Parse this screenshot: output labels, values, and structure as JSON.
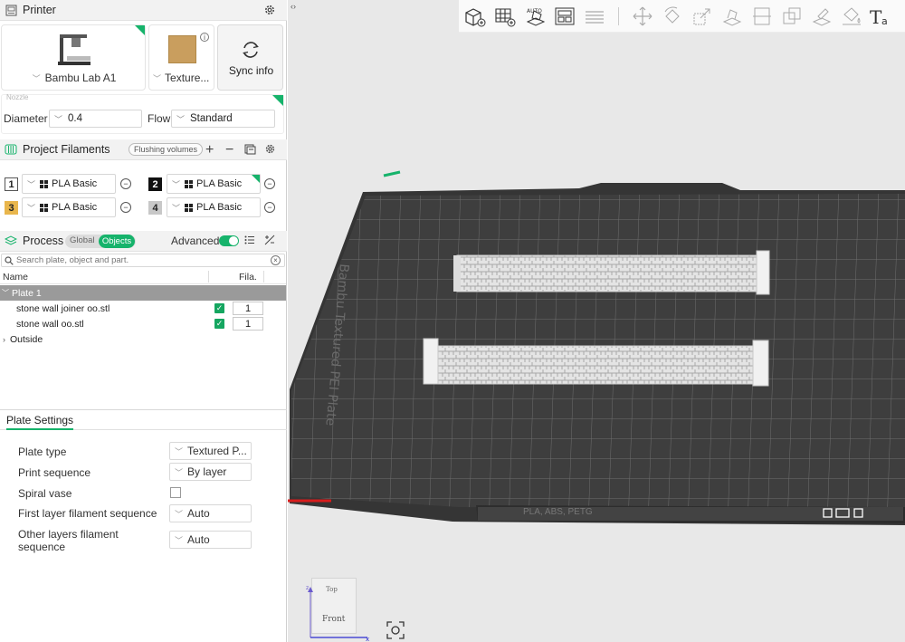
{
  "printer": {
    "section_title": "Printer",
    "model": "Bambu Lab A1",
    "plate": "Texture...",
    "sync_label": "Sync info",
    "nozzle_label": "Nozzle",
    "diameter_label": "Diameter",
    "diameter_value": "0.4",
    "flow_label": "Flow",
    "flow_value": "Standard"
  },
  "filaments": {
    "section_title": "Project Filaments",
    "flushing_label": "Flushing volumes",
    "items": [
      {
        "index": "1",
        "name": "PLA Basic",
        "color": "#ffffff"
      },
      {
        "index": "2",
        "name": "PLA Basic",
        "color": "#111111"
      },
      {
        "index": "3",
        "name": "PLA Basic",
        "color": "#e9b64c"
      },
      {
        "index": "4",
        "name": "PLA Basic",
        "color": "#c8c8c8"
      }
    ]
  },
  "process": {
    "section_title": "Process",
    "tab_global": "Global",
    "tab_objects": "Objects",
    "advanced_label": "Advanced",
    "search_placeholder": "Search plate, object and part."
  },
  "object_list": {
    "col_name": "Name",
    "col_fila": "Fila.",
    "plate_label": "Plate 1",
    "objects": [
      {
        "name": "stone wall joiner oo.stl",
        "count": "1"
      },
      {
        "name": "stone wall oo.stl",
        "count": "1"
      }
    ],
    "outside_label": "Outside"
  },
  "plate_settings": {
    "tab_label": "Plate Settings",
    "plate_type_label": "Plate type",
    "plate_type_value": "Textured P...",
    "print_sequence_label": "Print sequence",
    "print_sequence_value": "By layer",
    "spiral_vase_label": "Spiral vase",
    "first_layer_label": "First layer filament sequence",
    "first_layer_value": "Auto",
    "other_layers_label_1": "Other layers filament",
    "other_layers_label_2": "sequence",
    "other_layers_value": "Auto"
  },
  "viewport": {
    "bed_label": "Bambu Textured PEI Plate",
    "bed_bottom_label": "PLA, ABS, PETG",
    "orient_top": "Top",
    "orient_front": "Front",
    "accent_color": "#16b36b"
  }
}
